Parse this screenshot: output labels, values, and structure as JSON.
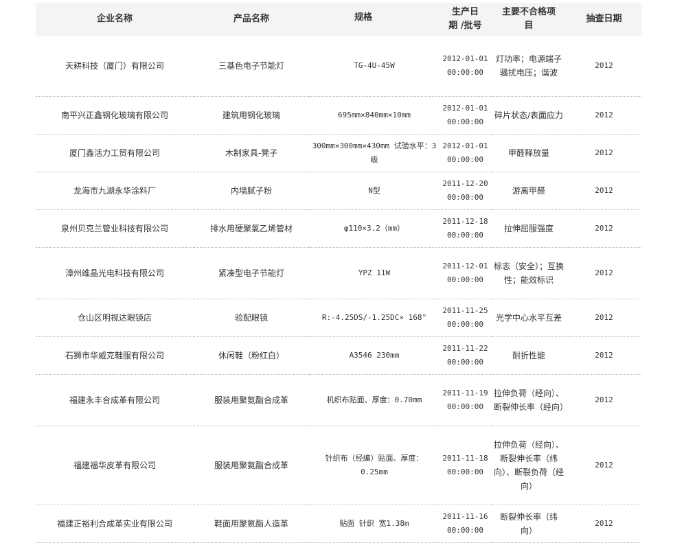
{
  "table": {
    "headers": {
      "company": "企业名称",
      "product": "产品名称",
      "spec": "规格",
      "date_batch_1": "生产日",
      "date_batch_2": "期 /批号",
      "defects_1": "主要不合格项",
      "defects_2": "目",
      "check_date": "抽查日期"
    },
    "rows": [
      {
        "company": "天耕科技（厦门）有限公司",
        "product": "三基色电子节能灯",
        "spec": "TG-4U-45W",
        "date": "2012-01-01",
        "time": "00:00:00",
        "defects": "灯功率；电源端子骚扰电压；谐波",
        "year": "2012"
      },
      {
        "company": "南平兴正鑫钢化玻璃有限公司",
        "product": "建筑用钢化玻璃",
        "spec": "695mm×840mm×10mm",
        "date": "2012-01-01",
        "time": "00:00:00",
        "defects": "碎片状态/表面应力",
        "year": "2012"
      },
      {
        "company": "厦门鑫活力工贸有限公司",
        "product": "木制家具-凳子",
        "spec": "300mm×300mm×430mm 试验水平：3级",
        "date": "2012-01-01",
        "time": "00:00:00",
        "defects": "甲醛释放量",
        "year": "2012"
      },
      {
        "company": "龙海市九湖永华涂料厂",
        "product": "内墙腻子粉",
        "spec": "N型",
        "date": "2011-12-20",
        "time": "00:00:00",
        "defects": "游离甲醛",
        "year": "2012"
      },
      {
        "company": "泉州贝克兰管业科技有限公司",
        "product": "排水用硬聚氯乙烯管材",
        "spec": "φ110×3.2（mm）",
        "date": "2011-12-18",
        "time": "00:00:00",
        "defects": "拉伸屈服强度",
        "year": "2012"
      },
      {
        "company": "漳州维晶光电科技有限公司",
        "product": "紧凑型电子节能灯",
        "spec": "YPZ 11W",
        "date": "2011-12-01",
        "time": "00:00:00",
        "defects": "标志（安全）；互换性；能效标识",
        "year": "2012"
      },
      {
        "company": "仓山区明视达眼镜店",
        "product": "验配眼镜",
        "spec": "R:-4.25DS/-1.25DC× 168°",
        "date": "2011-11-25",
        "time": "00:00:00",
        "defects": "光学中心水平互差",
        "year": "2012"
      },
      {
        "company": "石狮市华威克鞋服有限公司",
        "product": "休闲鞋（粉红白）",
        "spec": "A3546 230mm",
        "date": "2011-11-22",
        "time": "00:00:00",
        "defects": "耐折性能",
        "year": "2012"
      },
      {
        "company": "福建永丰合成革有限公司",
        "product": "服装用聚氨酯合成革",
        "spec": "机织布贴面、厚度：0.70mm",
        "date": "2011-11-19",
        "time": "00:00:00",
        "defects": "拉伸负荷（经向）、断裂伸长率（经向）",
        "year": "2012"
      },
      {
        "company": "福建福华皮革有限公司",
        "product": "服装用聚氨酯合成革",
        "spec": "针织布（经编）贴面、厚度：0.25mm",
        "date": "2011-11-18",
        "time": "00:00:00",
        "defects": "拉伸负荷（经向）、断裂伸长率（纬向）、断裂负荷（经向）",
        "year": "2012"
      },
      {
        "company": "福建正裕利合成革实业有限公司",
        "product": "鞋面用聚氨酯人造革",
        "spec": "贴面 针织 宽1.38m",
        "date": "2011-11-16",
        "time": "00:00:00",
        "defects": "断裂伸长率（纬向）",
        "year": "2012"
      }
    ]
  }
}
